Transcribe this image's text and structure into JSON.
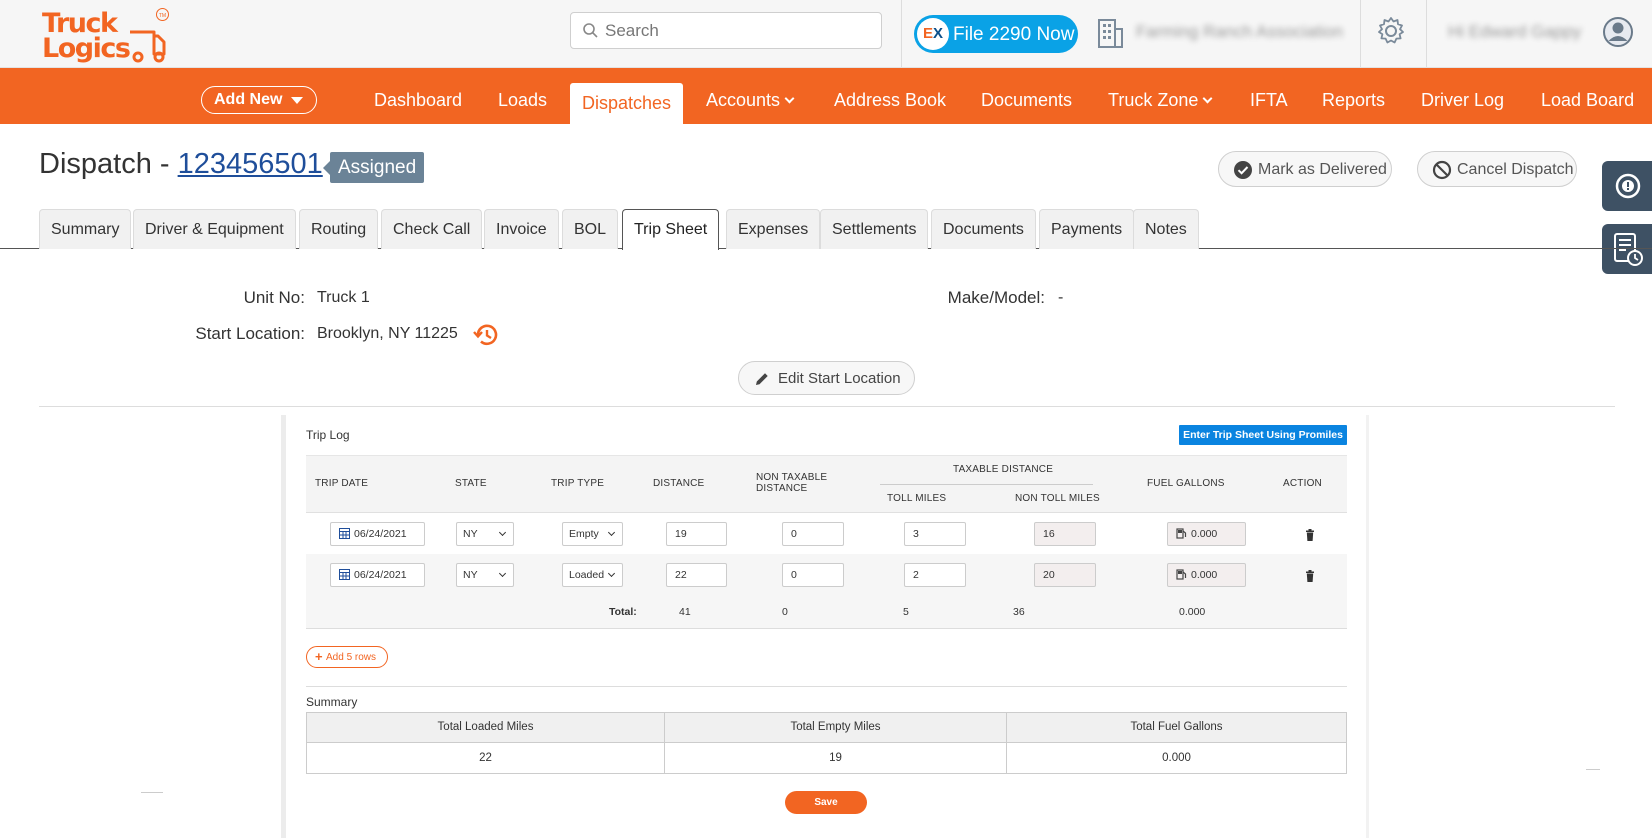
{
  "header": {
    "logo_line1": "Truck",
    "logo_line2": "Logics",
    "logo_tm": "TM",
    "search_placeholder": "Search",
    "file_button_prefix": "E",
    "file_button_x": "X",
    "file_button_label": "File 2290 Now",
    "org_name": "Farming Ranch Association",
    "user_name": "Hi Edward Gappy"
  },
  "nav": {
    "add_new_label": "Add New",
    "items": [
      {
        "label": "Dashboard"
      },
      {
        "label": "Loads"
      },
      {
        "label": "Dispatches"
      },
      {
        "label": "Accounts"
      },
      {
        "label": "Address Book"
      },
      {
        "label": "Documents"
      },
      {
        "label": "Truck Zone"
      },
      {
        "label": "IFTA"
      },
      {
        "label": "Reports"
      },
      {
        "label": "Driver Log"
      },
      {
        "label": "Load Board"
      }
    ],
    "active": "Dispatches"
  },
  "dispatch": {
    "title_prefix": "Dispatch - ",
    "number": "123456501",
    "status": "Assigned",
    "mark_delivered_label": "Mark as Delivered",
    "cancel_label": "Cancel Dispatch"
  },
  "tabs": [
    {
      "label": "Summary"
    },
    {
      "label": "Driver & Equipment"
    },
    {
      "label": "Routing"
    },
    {
      "label": "Check Call"
    },
    {
      "label": "Invoice"
    },
    {
      "label": "BOL"
    },
    {
      "label": "Trip Sheet"
    },
    {
      "label": "Expenses"
    },
    {
      "label": "Settlements"
    },
    {
      "label": "Documents"
    },
    {
      "label": "Payments"
    },
    {
      "label": "Notes"
    }
  ],
  "active_tab": "Trip Sheet",
  "unit": {
    "unit_no_label": "Unit No:",
    "unit_no": "Truck 1",
    "make_model_label": "Make/Model:",
    "make_model": "-",
    "start_location_label": "Start Location:",
    "start_location": "Brooklyn, NY 11225",
    "edit_start_label": "Edit Start Location"
  },
  "trip_log": {
    "title": "Trip Log",
    "promiles_label": "Enter Trip Sheet Using Promiles",
    "columns": {
      "trip_date": "TRIP DATE",
      "state": "STATE",
      "trip_type": "TRIP TYPE",
      "distance": "DISTANCE",
      "non_taxable_1": "NON TAXABLE",
      "non_taxable_2": "DISTANCE",
      "taxable": "TAXABLE DISTANCE",
      "toll": "TOLL MILES",
      "non_toll": "NON TOLL MILES",
      "fuel": "FUEL GALLONS",
      "action": "ACTION"
    },
    "rows": [
      {
        "date": "06/24/2021",
        "state": "NY",
        "type": "Empty",
        "distance": "19",
        "non_taxable": "0",
        "toll": "3",
        "non_toll": "16",
        "fuel": "0.000"
      },
      {
        "date": "06/24/2021",
        "state": "NY",
        "type": "Loaded",
        "distance": "22",
        "non_taxable": "0",
        "toll": "2",
        "non_toll": "20",
        "fuel": "0.000"
      }
    ],
    "totals": {
      "label": "Total:",
      "distance": "41",
      "non_taxable": "0",
      "toll": "5",
      "non_toll": "36",
      "fuel": "0.000"
    },
    "add_rows_label": "Add 5 rows"
  },
  "summary": {
    "title": "Summary",
    "headers": [
      "Total Loaded Miles",
      "Total Empty Miles",
      "Total Fuel Gallons"
    ],
    "values": [
      "22",
      "19",
      "0.000"
    ],
    "save_label": "Save"
  },
  "colors": {
    "brand_orange": "#f26522",
    "nav_active_text": "#f26522",
    "file_button": "#0aa2e6",
    "promiles_button": "#0a84e0",
    "status_badge": "#6b8397",
    "side_panel": "#3e5164"
  }
}
